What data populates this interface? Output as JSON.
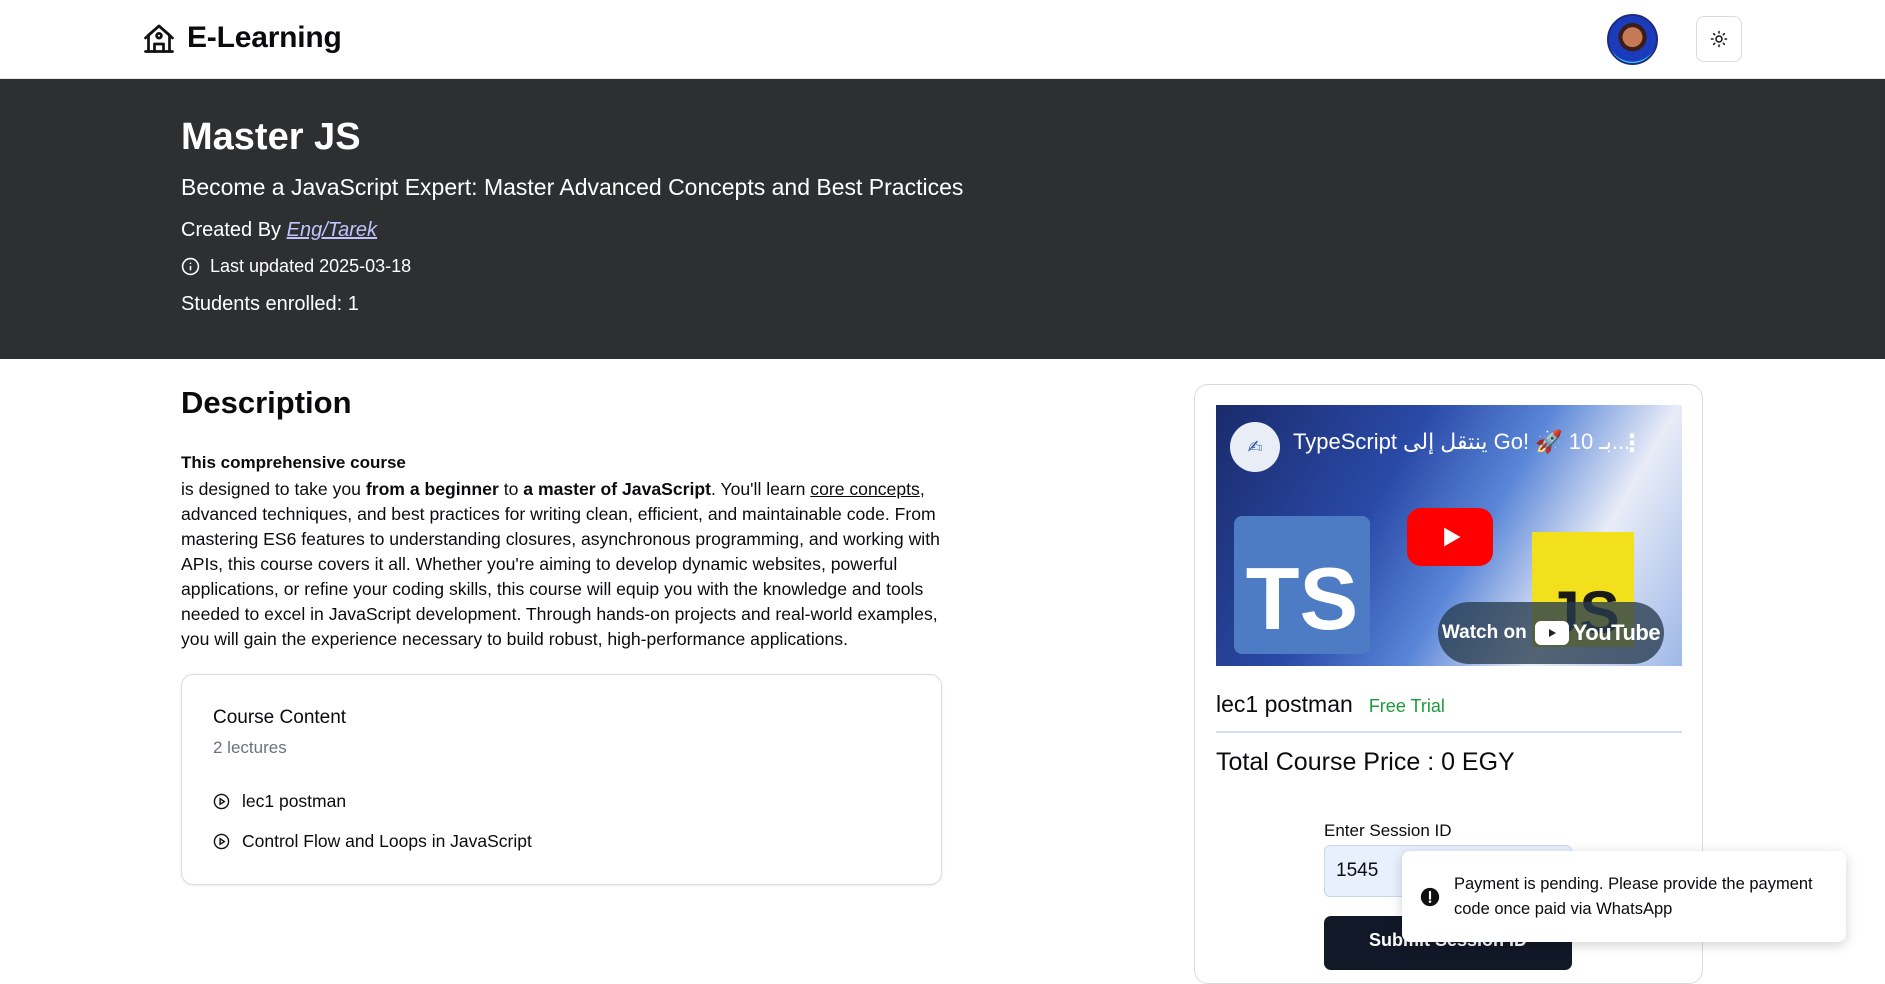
{
  "header": {
    "brand_name": "E-Learning",
    "logo_icon": "school-building-icon",
    "avatar_icon": "user-avatar",
    "theme_icon": "sun-icon"
  },
  "hero": {
    "title": "Master JS",
    "subtitle": "Become a JavaScript Expert: Master Advanced Concepts and Best Practices",
    "created_by_label": "Created By",
    "creator_name": "Eng/Tarek",
    "last_updated": "Last updated 2025-03-18",
    "students_enrolled": "Students enrolled: 1",
    "background_color": "#2d2f31"
  },
  "description": {
    "heading": "Description",
    "lead": "This comprehensive course",
    "body_parts": [
      "is designed to take you ",
      "from a beginner",
      " to ",
      "a master of JavaScript",
      ". You'll learn ",
      "core concepts",
      ", advanced techniques, and best practices for writing clean, efficient, and maintainable code. From mastering ES6 features to understanding closures, asynchronous programming, and working with APIs, this course covers it all. Whether you're aiming to develop dynamic websites, powerful applications, or refine your coding skills, this course will equip you with the knowledge and tools needed to excel in JavaScript development. Through hands-on projects and real-world examples, you will gain the experience necessary to build robust, high-performance applications."
    ]
  },
  "course_content": {
    "title": "Course Content",
    "count": "2 lectures",
    "lectures": [
      "lec1 postman",
      "Control Flow and Loops in JavaScript"
    ]
  },
  "side": {
    "video": {
      "title": "TypeScript ينتقل إلى Go! 🚀 10 بـ...",
      "watch_on": "Watch on",
      "youtube": "YouTube",
      "ts_label": "TS",
      "js_label": "JS"
    },
    "lesson_name": "lec1 postman",
    "free_trial": "Free Trial",
    "total_price": "Total Course Price : 0 EGY",
    "session_label": "Enter Session ID",
    "session_value": "1545",
    "submit_label": "Submit Session ID"
  },
  "toast": {
    "message": "Payment is pending. Please provide the payment code once paid via WhatsApp"
  },
  "colors": {
    "free_trial": "#1a9c3a",
    "link": "#c0c4fc",
    "submit_bg": "#111827",
    "youtube_red": "#ff0000"
  }
}
